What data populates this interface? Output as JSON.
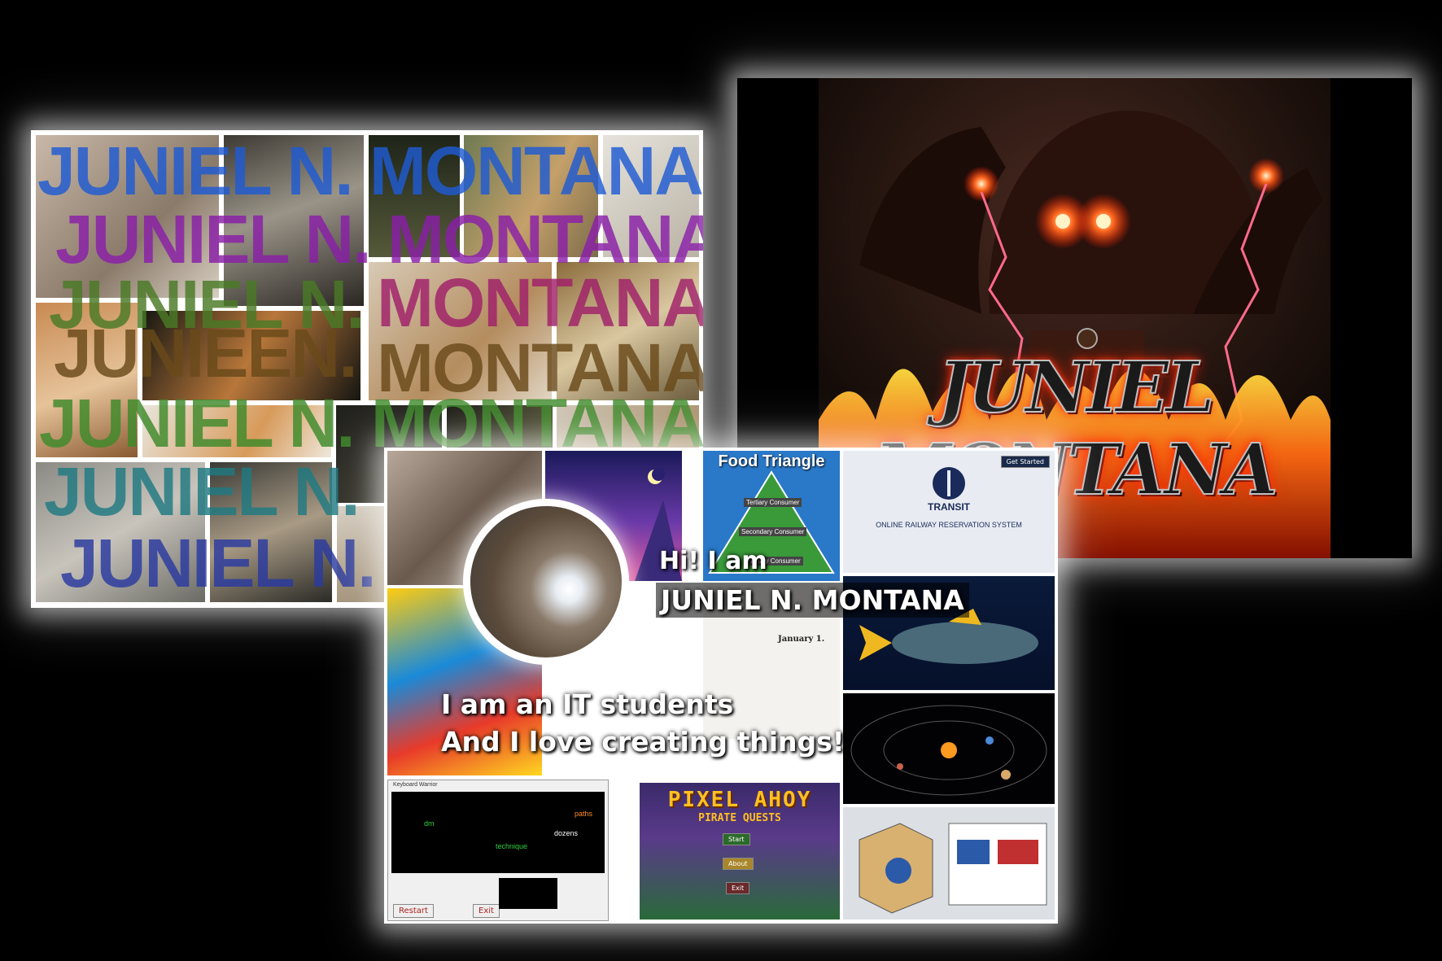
{
  "collage": {
    "name_lines": [
      "JUNIEL N. MONTANA",
      "JUNIEL N. MONTANA",
      "JUNIEL N.",
      "JUNIEEN.",
      "JUNIEL N. MONTANA",
      "JUNIEL N. ",
      "JUNIEL N. "
    ],
    "right_words": [
      "MONTANA",
      "MONTANA"
    ]
  },
  "poster": {
    "title": "JUNIEL MONTANA",
    "colors": {
      "fire": "#ff4a12",
      "eyes": "#ff2a10",
      "sky": "#2a1612"
    }
  },
  "portfolio": {
    "greeting_line1": "Hi! I am",
    "greeting_line2": "JUNIEL N. MONTANA",
    "intro_line1": "I am an IT students",
    "intro_line2": "And I love creating things!",
    "tiles": {
      "food_triangle": {
        "title": "Food Triangle",
        "levels": [
          "Tertiary Consumer",
          "Secondary Consumer",
          "Primary Consumer"
        ]
      },
      "transit": {
        "logo_text": "TRANSIT",
        "subtitle": "ONLINE RAILWAY RESERVATION SYSTEM",
        "button": "Get Started"
      },
      "newsletter": {
        "date": "January 1."
      },
      "pixel_ahoy": {
        "title": "PIXEL AHOY",
        "subtitle": "PIRATE QUESTS",
        "buttons": [
          "Start",
          "About",
          "Exit"
        ]
      },
      "keyboard_game": {
        "window_title": "Keyboard Warrior",
        "words": [
          "paths",
          "dm",
          "dozens",
          "technique"
        ],
        "buttons": [
          "Restart",
          "Exit"
        ]
      }
    }
  }
}
